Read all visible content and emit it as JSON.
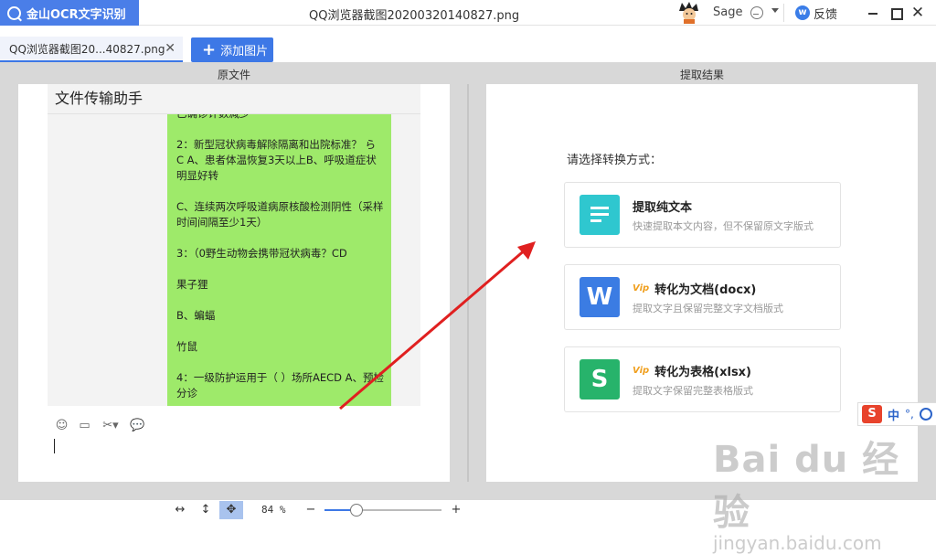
{
  "app": {
    "name": "金山OCR文字识别",
    "document_title": "QQ浏览器截图20200320140827.png",
    "user_name": "Sage",
    "feedback_label": "反馈",
    "feedback_icon_letter": "w",
    "close_glyph": "✕"
  },
  "tabs": {
    "file_tab_label": "QQ浏览器截图20...40827.png",
    "close_glyph": "✕",
    "add_button_label": "添加图片",
    "add_button_plus": "+"
  },
  "panels": {
    "source_header": "原文件",
    "result_header": "提取结果"
  },
  "source_image": {
    "chat_title": "文件传输助手",
    "message_paragraphs": [
      "已确诊计数减少",
      "2：新型冠状病毒解除隔离和出院标准？ ら C A、患者体温恢复3天以上B、呼吸道症状明显好转",
      "C、连续两次呼吸道病原核酸检测阴性（采样时间间隔至少1天）",
      "3：（0野生动物会携带冠状病毒？CD",
      "果子狸",
      "B、蝙蝠",
      "竹鼠",
      "4：一级防护运用于（ ）场所AECD A、预检分诊"
    ],
    "toolbar_icons": [
      "smiley-icon",
      "folder-icon",
      "scissors-icon",
      "chat-bubble-icon"
    ],
    "toolbar_glyphs": [
      "☺",
      "▭",
      "✂▾",
      "💬"
    ]
  },
  "result": {
    "prompt": "请选择转换方式：",
    "options": [
      {
        "title": "提取纯文本",
        "description": "快速提取本文内容，但不保留原文字版式",
        "vip": false,
        "icon": "text-lines-icon",
        "icon_glyph": "",
        "color": "#2fc7cf"
      },
      {
        "title": "转化为文档(docx)",
        "description": "提取文字且保留完整文字文档版式",
        "vip": true,
        "icon": "word-doc-icon",
        "icon_glyph": "W",
        "color": "#3b7ce3"
      },
      {
        "title": "转化为表格(xlsx)",
        "description": "提取文字保留完整表格版式",
        "vip": true,
        "icon": "spreadsheet-icon",
        "icon_glyph": "S",
        "color": "#27b36b"
      }
    ],
    "vip_badge": "Vip"
  },
  "bottom_bar": {
    "zoom_value": "84 %",
    "zoom_fraction": 0.27,
    "fit_width_glyph": "↔",
    "fit_height_glyph": "↕",
    "move_glyph": "✥",
    "zoom_out_glyph": "−",
    "zoom_in_glyph": "+"
  },
  "overlays": {
    "ime_logo": "S",
    "ime_lang": "中",
    "ime_punct": "°,",
    "watermark_brand": "Bai du 经验",
    "watermark_url": "jingyan.baidu.com",
    "annotation_arrow_color": "#e02020"
  },
  "colors": {
    "accent": "#3d78e6",
    "brand_bar": "#4a7ee8",
    "chat_bubble": "#9eea6a",
    "panel_bg": "#d8d8d8"
  }
}
